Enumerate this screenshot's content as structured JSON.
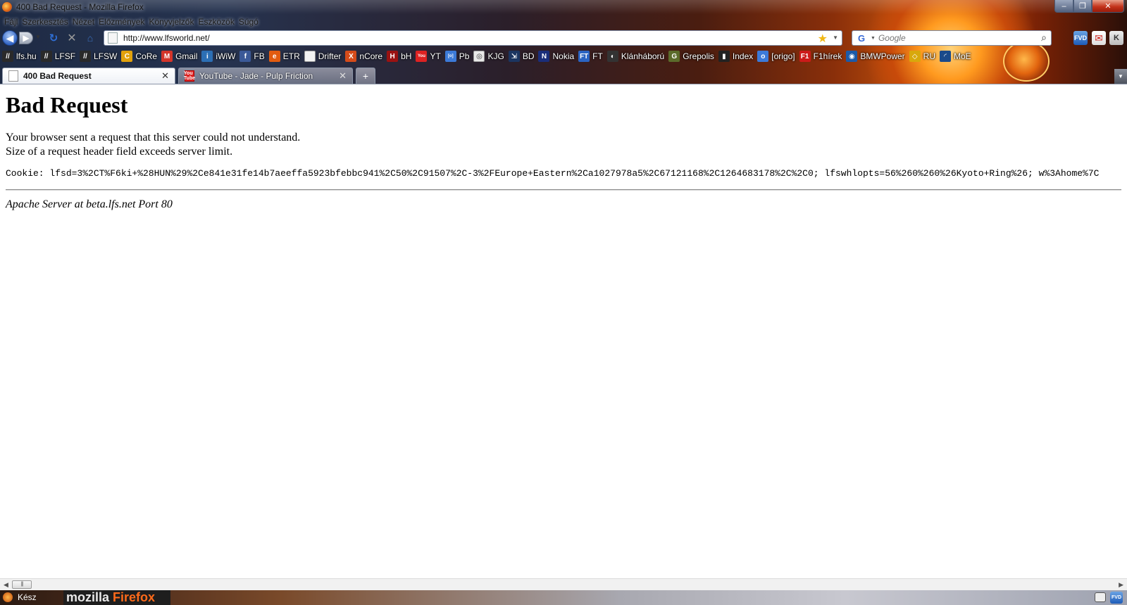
{
  "window": {
    "title": "400 Bad Request - Mozilla Firefox",
    "minimize": "–",
    "maximize": "❐",
    "close": "✕"
  },
  "menu": {
    "items": [
      "Fájl",
      "Szerkesztés",
      "Nézet",
      "Előzmények",
      "Könyvjelzők",
      "Eszközök",
      "Súgó"
    ]
  },
  "nav": {
    "back": "◀",
    "forward": "▶",
    "history_drop": "▼",
    "reload": "↻",
    "stop": "✕",
    "home": "⌂",
    "url": "http://www.lfsworld.net/",
    "star": "★",
    "url_drop": "▼"
  },
  "search": {
    "engine": "G",
    "engine_drop": "▼",
    "placeholder": "Google",
    "go": "⌕"
  },
  "extensions": {
    "fvd": "FVD",
    "red": "✉",
    "k": "K"
  },
  "bookmarks": [
    {
      "label": "lfs.hu",
      "icon": "lfs-icon",
      "color": "#2a2a2a",
      "glyph": "//"
    },
    {
      "label": "LFSF",
      "icon": "lfsf-icon",
      "color": "#2a2a2a",
      "glyph": "//"
    },
    {
      "label": "LFSW",
      "icon": "lfsw-icon",
      "color": "#2a2a2a",
      "glyph": "//"
    },
    {
      "label": "CoRe",
      "icon": "core-icon",
      "color": "#e2a10c",
      "glyph": "C"
    },
    {
      "label": "Gmail",
      "icon": "gmail-icon",
      "color": "#d4352a",
      "glyph": "M"
    },
    {
      "label": "iWiW",
      "icon": "iwiw-icon",
      "color": "#2c6fb5",
      "glyph": "i"
    },
    {
      "label": "FB",
      "icon": "facebook-icon",
      "color": "#3b5998",
      "glyph": "f"
    },
    {
      "label": "ETR",
      "icon": "etr-icon",
      "color": "#e25b0f",
      "glyph": "e"
    },
    {
      "label": "Drifter",
      "icon": "page-icon",
      "color": "#f2f2f2",
      "glyph": ""
    },
    {
      "label": "nCore",
      "icon": "ncore-icon",
      "color": "#d54b1a",
      "glyph": "X"
    },
    {
      "label": "bH",
      "icon": "bh-icon",
      "color": "#9a1212",
      "glyph": "H"
    },
    {
      "label": "YT",
      "icon": "youtube-icon",
      "color": "#d22",
      "glyph": "You"
    },
    {
      "label": "Pb",
      "icon": "pb-icon",
      "color": "#3c7ad8",
      "glyph": "[o]"
    },
    {
      "label": "KJG",
      "icon": "kjg-icon",
      "color": "#e9e9e9",
      "glyph": "◎"
    },
    {
      "label": "BD",
      "icon": "bd-icon",
      "color": "#1b3560",
      "glyph": "⇲"
    },
    {
      "label": "Nokia",
      "icon": "nokia-icon",
      "color": "#1a2e7a",
      "glyph": "N"
    },
    {
      "label": "FT",
      "icon": "ft-icon",
      "color": "#2b64c2",
      "glyph": "FT"
    },
    {
      "label": "Klánháború",
      "icon": "klan-icon",
      "color": "#333",
      "glyph": "◐"
    },
    {
      "label": "Grepolis",
      "icon": "grepolis-icon",
      "color": "#5b6b2b",
      "glyph": "G"
    },
    {
      "label": "Index",
      "icon": "index-icon",
      "color": "#222",
      "glyph": "▮"
    },
    {
      "label": "[origo]",
      "icon": "origo-icon",
      "color": "#3c7ad8",
      "glyph": "o"
    },
    {
      "label": "F1hírek",
      "icon": "f1-icon",
      "color": "#cc1a1a",
      "glyph": "F1"
    },
    {
      "label": "BMWPower",
      "icon": "bmw-icon",
      "color": "#1c5aa8",
      "glyph": "◉"
    },
    {
      "label": "RU",
      "icon": "ru-icon",
      "color": "#d8a80c",
      "glyph": "◇"
    },
    {
      "label": "MoE",
      "icon": "moe-icon",
      "color": "#1b4a8a",
      "glyph": "◜"
    }
  ],
  "tabs": [
    {
      "label": "400 Bad Request",
      "close": "✕"
    },
    {
      "label": "YouTube - Jade - Pulp Friction",
      "close": "✕",
      "favicon": "You Tube"
    }
  ],
  "newtab": "+",
  "tablist": "▼",
  "page": {
    "heading": "Bad Request",
    "line1": "Your browser sent a request that this server could not understand.",
    "line2": "Size of a request header field exceeds server limit.",
    "cookie": "Cookie: lfsd=3%2CT%F6ki+%28HUN%29%2Ce841e31fe14b7aeeffa5923bfebbc941%2C50%2C91507%2C-3%2FEurope+Eastern%2Ca1027978a5%2C67121168%2C1264683178%2C%2C0; lfswhlopts=56%260%260%26Kyoto+Ring%26; w%3Ahome%7C",
    "address": "Apache Server at beta.lfs.net Port 80"
  },
  "scrollbar": {
    "left": "◀",
    "right": "▶",
    "grip": "|||"
  },
  "status": {
    "text": "Kész",
    "brand_1": "mozilla",
    "brand_2": "Firefox",
    "fvd": "FVD"
  }
}
